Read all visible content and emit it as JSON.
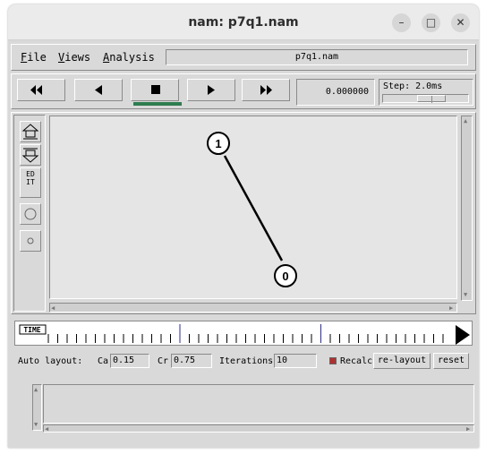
{
  "window": {
    "title": "nam: p7q1.nam",
    "controls": [
      "–",
      "□",
      "✕"
    ]
  },
  "menubar": {
    "items": [
      {
        "first": "F",
        "rest": "ile"
      },
      {
        "first": "V",
        "rest": "iews"
      },
      {
        "first": "A",
        "rest": "nalysis"
      }
    ],
    "filename": "p7q1.nam"
  },
  "controls": {
    "buttons": [
      "rewind-fast",
      "rewind",
      "stop",
      "play",
      "fast-forward"
    ],
    "time": "0.000000",
    "step_label": "Step: 2.0ms",
    "step_slider_position": 0.5
  },
  "tools": {
    "edit_label_1": "ED",
    "edit_label_2": "IT"
  },
  "canvas": {
    "nodes": [
      "1",
      "0"
    ],
    "links": [
      {
        "from": "1",
        "to": "0"
      }
    ]
  },
  "timeline": {
    "label": "TIME"
  },
  "layout": {
    "auto_layout_label": "Auto layout:",
    "ca_label": "Ca",
    "ca_value": "0.15",
    "cr_label": "Cr",
    "cr_value": "0.75",
    "iterations_label": "Iterations",
    "iterations_value": "10",
    "recalc_label": "Recalc",
    "recalc_checked": true,
    "relayout_label": "re-layout",
    "reset_label": "reset"
  },
  "colors": {
    "accent_stop_indicator": "#2e7d4f",
    "recalc_check": "#b03030",
    "timeline_marker": "#2b2b9e"
  }
}
